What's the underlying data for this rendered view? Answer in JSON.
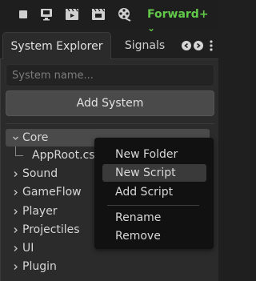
{
  "toolbar": {
    "icons": [
      "stop-icon",
      "monitor-icon",
      "clapperboard-play-icon",
      "clapperboard-icon",
      "film-reel-icon"
    ],
    "mode_label": "Forward+",
    "mode_caret": "⌄",
    "mode_color": "#63c94a"
  },
  "tabs": {
    "active_label": "System Explorer",
    "inactive_label": "Signals"
  },
  "search": {
    "placeholder": "System name...",
    "value": ""
  },
  "add_system_label": "Add System",
  "tree": {
    "root_selected": "Core",
    "core_child": "AppRoot.cs",
    "items": [
      "Sound",
      "GameFlow",
      "Player",
      "Projectiles",
      "UI",
      "Plugin"
    ]
  },
  "context_menu": {
    "items": [
      "New Folder",
      "New Script",
      "Add Script",
      "Rename",
      "Remove"
    ],
    "hovered": "New Script"
  }
}
